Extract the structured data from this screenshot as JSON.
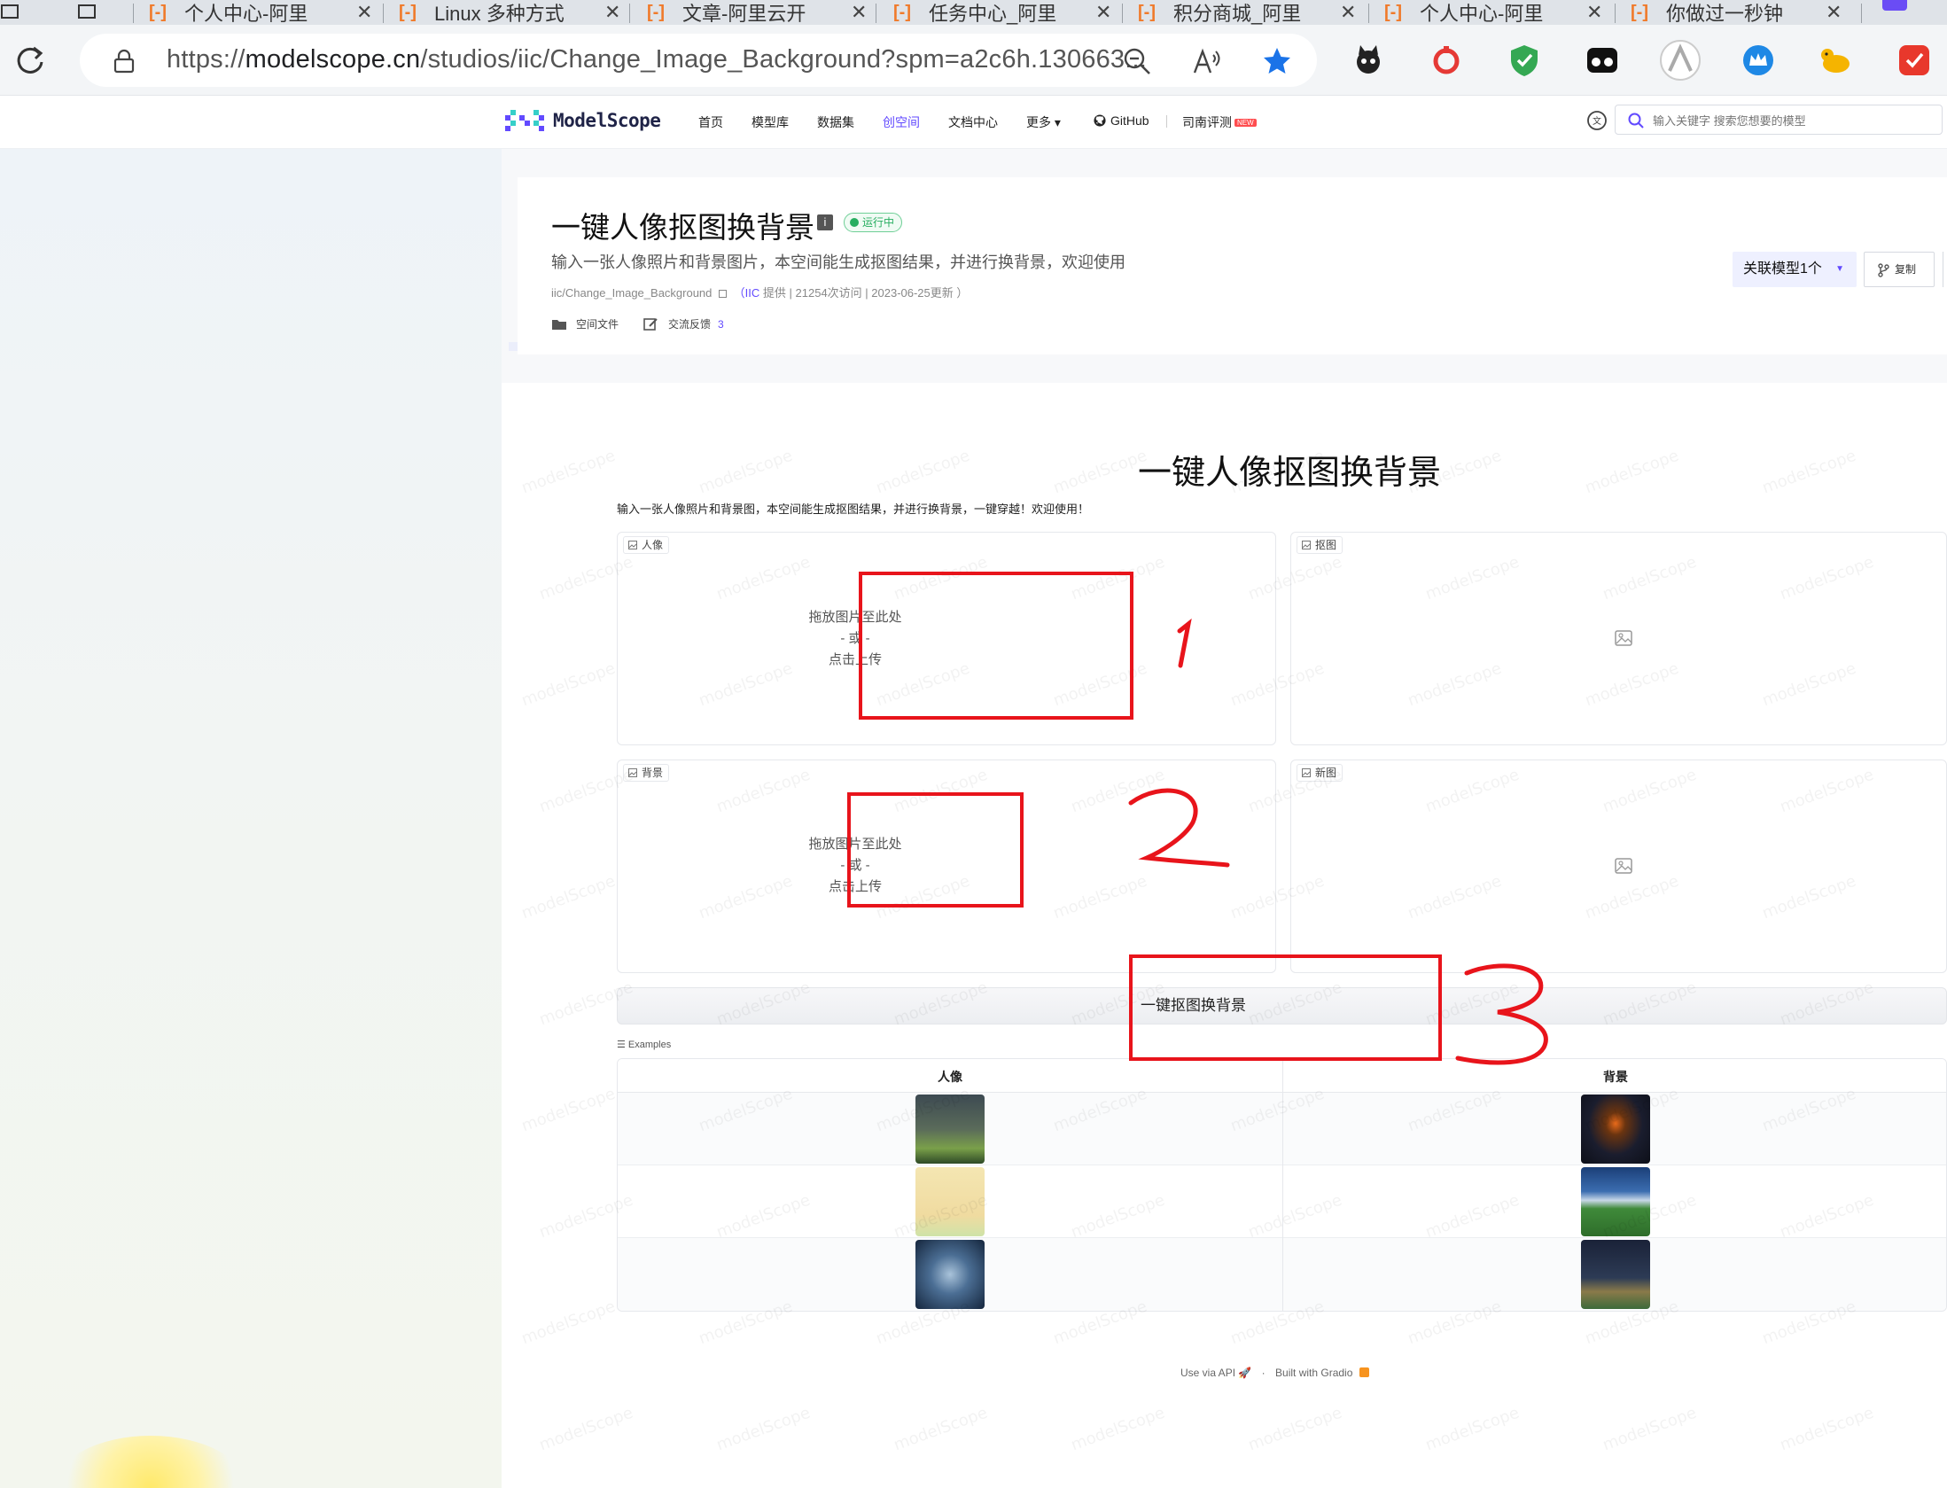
{
  "browser": {
    "tabs": [
      {
        "label": "个人中心-阿里"
      },
      {
        "label": "Linux 多种方式"
      },
      {
        "label": "文章-阿里云开"
      },
      {
        "label": "任务中心_阿里"
      },
      {
        "label": "积分商城_阿里"
      },
      {
        "label": "个人中心-阿里"
      },
      {
        "label": "你做过一秒钟"
      }
    ],
    "url_prefix": "https://",
    "url_host": "modelscope.cn",
    "url_path": "/studios/iic/Change_Image_Background?spm=a2c6h.130663..."
  },
  "site_nav": {
    "brand": "ModelScope",
    "links": [
      "首页",
      "模型库",
      "数据集",
      "创空间",
      "文档中心",
      "更多 ▾",
      "GitHub",
      "司南评测"
    ],
    "active_link": "创空间",
    "new_badge": "NEW",
    "search_placeholder": "输入关键字 搜索您想要的模型"
  },
  "studio": {
    "title": "一键人像抠图换背景",
    "status": "运行中",
    "description": "输入一张人像照片和背景图片，本空间能生成抠图结果，并进行换背景，欢迎使用",
    "repo": "iic/Change_Image_Background",
    "provider": "IIC",
    "meta_rest": "提供 | 21254次访问 | 2023-06-25更新 ）",
    "files_link": "空间文件",
    "feedback_link": "交流反馈",
    "feedback_count": "3",
    "related_models": "关联模型1个",
    "copy_label": "复制"
  },
  "app": {
    "title": "一键人像抠图换背景",
    "description": "输入一张人像照片和背景图，本空间能生成抠图结果，并进行换背景，一键穿越！欢迎使用！",
    "inputs": [
      {
        "label": "人像",
        "drop_text": "拖放图片至此处",
        "or_text": "- 或 -",
        "click_text": "点击上传"
      },
      {
        "label": "背景",
        "drop_text": "拖放图片至此处",
        "or_text": "- 或 -",
        "click_text": "点击上传"
      }
    ],
    "outputs": [
      {
        "label": "抠图"
      },
      {
        "label": "新图"
      }
    ],
    "run_button": "一键抠图换背景",
    "examples_label": "Examples",
    "examples_headers": [
      "人像",
      "背景"
    ],
    "footer_api": "Use via API",
    "footer_gradio": "Built with Gradio",
    "footer_sep": "·"
  },
  "annotations": [
    "1",
    "2",
    "3"
  ],
  "watermark": "modelScope",
  "colors": {
    "accent": "#624aff",
    "annotation_red": "#e8141b",
    "status_green": "#27ae60"
  }
}
